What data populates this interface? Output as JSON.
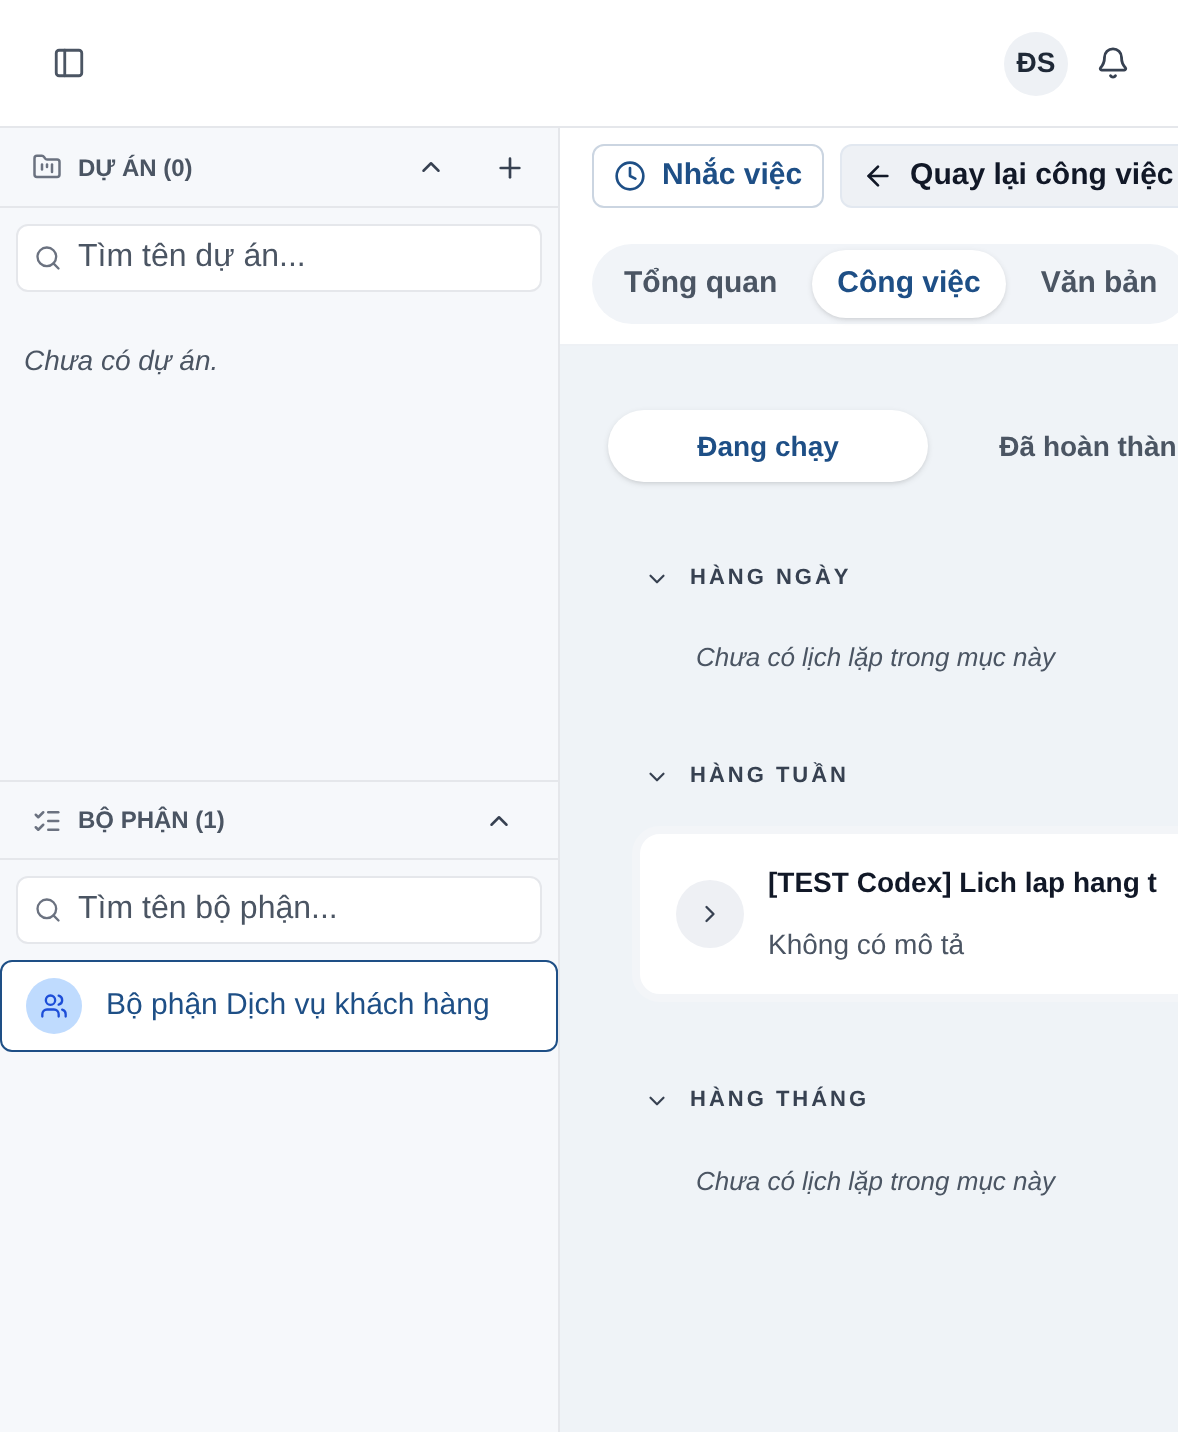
{
  "topbar": {
    "avatar": "ĐS"
  },
  "sidebar": {
    "projects": {
      "title": "DỰ ÁN (0)",
      "expanded": true,
      "search": {
        "placeholder": "Tìm tên dự án..."
      },
      "empty": "Chưa có dự án."
    },
    "departments": {
      "title": "BỘ PHẬN (1)",
      "expanded": true,
      "search": {
        "placeholder": "Tìm tên bộ phận..."
      },
      "items": [
        {
          "label": "Bộ phận Dịch vụ khách hàng",
          "selected": true
        }
      ]
    }
  },
  "actions": [
    {
      "label": "Nhắc việc",
      "kind": "reminder"
    },
    {
      "label": "Quay lại công việc",
      "kind": "back"
    }
  ],
  "tabs": [
    {
      "label": "Tổng quan",
      "selected": false
    },
    {
      "label": "Công việc",
      "selected": true
    },
    {
      "label": "Văn bản",
      "selected": false
    }
  ],
  "subtabs": [
    {
      "label": "Đang chạy",
      "selected": true
    },
    {
      "label": "Đã hoàn thàn",
      "selected": false
    }
  ],
  "groups": [
    {
      "title": "HÀNG NGÀY",
      "expanded": true,
      "empty": "Chưa có lịch lặp trong mục này"
    },
    {
      "title": "HÀNG TUẦN",
      "expanded": true,
      "items": [
        {
          "title": "[TEST Codex] Lich lap hang t",
          "description": "Không có mô tả"
        }
      ]
    },
    {
      "title": "HÀNG THÁNG",
      "expanded": true,
      "empty": "Chưa có lịch lặp trong mục này"
    }
  ]
}
